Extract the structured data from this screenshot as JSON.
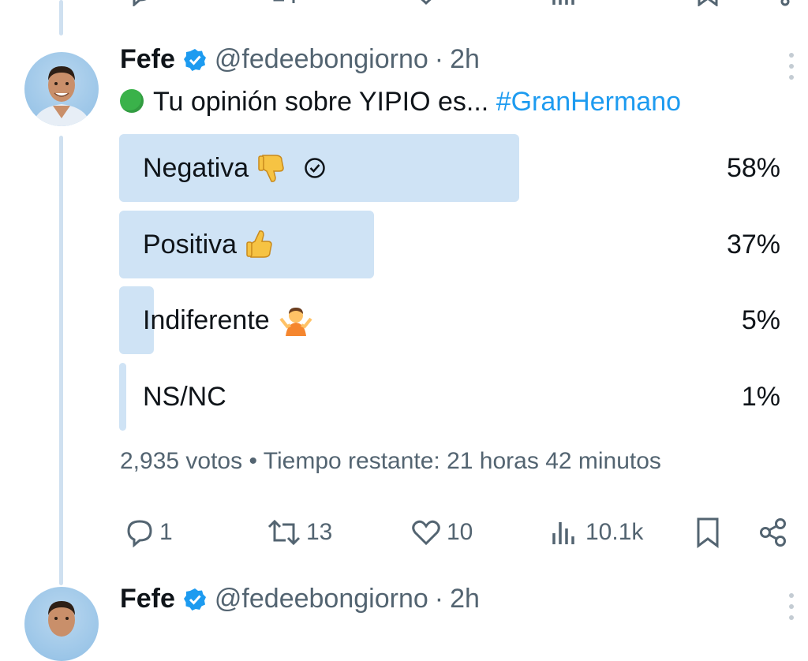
{
  "tweet": {
    "author_name": "Fefe",
    "handle": "@fedeebongiorno",
    "separator": "·",
    "time": "2h",
    "text": "Tu opinión sobre YIPIO es...",
    "hashtag": "#GranHermano",
    "status_emoji": "green-circle"
  },
  "poll": {
    "options": [
      {
        "label": "Negativa",
        "percent_text": "58%",
        "percent": 58,
        "emoji": "thumbs-down",
        "selected": true
      },
      {
        "label": "Positiva",
        "percent_text": "37%",
        "percent": 37,
        "emoji": "thumbs-up",
        "selected": false
      },
      {
        "label": "Indiferente",
        "percent_text": "5%",
        "percent": 5,
        "emoji": "person-shrugging",
        "selected": false
      },
      {
        "label": "NS/NC",
        "percent_text": "1%",
        "percent": 1,
        "emoji": "",
        "selected": false
      }
    ],
    "votes": "2,935 votos",
    "meta_separator": "•",
    "time_remaining": "Tiempo restante: 21 horas 42 minutos"
  },
  "actions": {
    "replies": "1",
    "retweets": "13",
    "likes": "10",
    "views": "10.1k"
  },
  "next_tweet": {
    "author_name": "Fefe",
    "handle": "@fedeebongiorno",
    "separator": "·",
    "time": "2h"
  },
  "colors": {
    "accent": "#1d9bf0",
    "poll_bar": "#cfe3f5",
    "secondary_text": "#536471",
    "thread_line": "#cfe0f0"
  }
}
